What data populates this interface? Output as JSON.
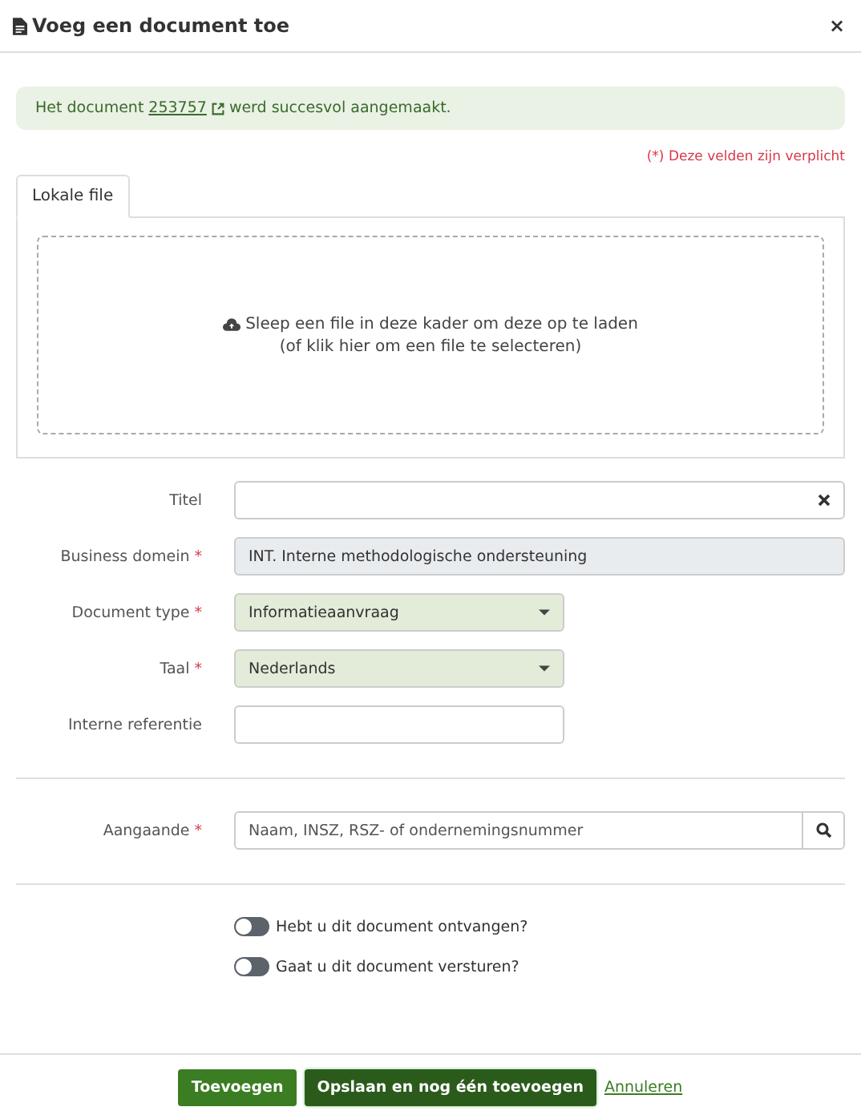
{
  "window": {
    "title": "Voeg een document toe",
    "close": "×"
  },
  "alert": {
    "before": "Het document",
    "link": "253757",
    "after": "werd succesvol aangemaakt."
  },
  "required_note": "(*) Deze velden zijn verplicht",
  "tabs": [
    {
      "label": "Lokale file",
      "selected": true
    }
  ],
  "dropzone": {
    "line1": "Sleep een file in deze kader om deze op te laden",
    "line2": "(of klik hier om een file te selecteren)"
  },
  "fields": [
    {
      "label": "Titel",
      "kind": "text",
      "wide": true,
      "clearable": true
    },
    {
      "label": "Business domein",
      "required_mark": "*",
      "kind": "readonly",
      "wide": true,
      "value": "INT. Interne methodologische ondersteuning"
    },
    {
      "label": "Document type",
      "required_mark": "*",
      "kind": "select",
      "wide": false,
      "value": "Informatieaanvraag"
    },
    {
      "label": "Taal",
      "required_mark": "*",
      "kind": "select",
      "wide": false,
      "value": "Nederlands"
    },
    {
      "label": "Interne referentie",
      "kind": "text",
      "wide": false
    }
  ],
  "lookup": {
    "label": "Aangaande",
    "required_mark": "*",
    "placeholder": "Naam, INSZ, RSZ- of ondernemingsnummer"
  },
  "toggles": [
    {
      "label": "Hebt u dit document ontvangen?",
      "on": false
    },
    {
      "label": "Gaat u dit document versturen?",
      "on": false
    }
  ],
  "buttons": [
    {
      "label": "Toevoegen",
      "kind": "primary"
    },
    {
      "label": "Opslaan en nog één toevoegen",
      "kind": "primary-dark"
    },
    {
      "label": "Annuleren",
      "kind": "link"
    }
  ]
}
